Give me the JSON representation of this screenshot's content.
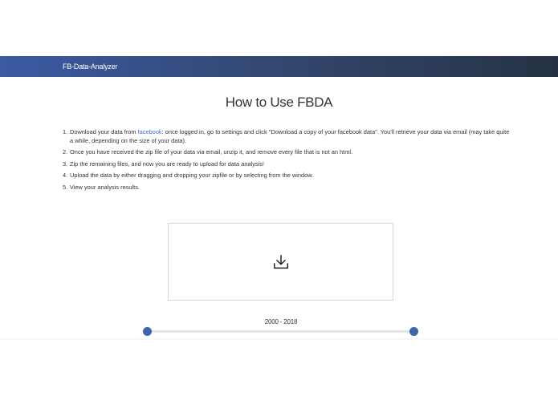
{
  "navbar": {
    "brand": "FB-Data-Analyzer"
  },
  "page": {
    "title": "How to Use FBDA"
  },
  "steps": [
    {
      "num": "1.",
      "pre": "Download your data from ",
      "link": "facebook",
      "post": ": once logged in, go to settings and click \"Download a copy of your facebook data\". You'll retrieve your data via email (may take quite a while, depending on the size of your data)."
    },
    {
      "num": "2.",
      "text": "Once you have received the zip file of your data via email, unzip it, and remove every file that is not an html."
    },
    {
      "num": "3.",
      "text": "Zip the remaining files, and now you are ready to upload for data analysis!"
    },
    {
      "num": "4.",
      "text": "Upload the data by either dragging and dropping your zipfile or by selecting from the window."
    },
    {
      "num": "5.",
      "text": "View your analysis results."
    }
  ],
  "dropzone": {
    "icon": "download-icon"
  },
  "range": {
    "label": "2000 - 2018",
    "min": 2000,
    "max": 2018
  },
  "colors": {
    "navbar_start": "#3b5aa3",
    "navbar_end": "#263244",
    "link": "#3b6fd1",
    "slider_handle": "#3c66ad"
  }
}
